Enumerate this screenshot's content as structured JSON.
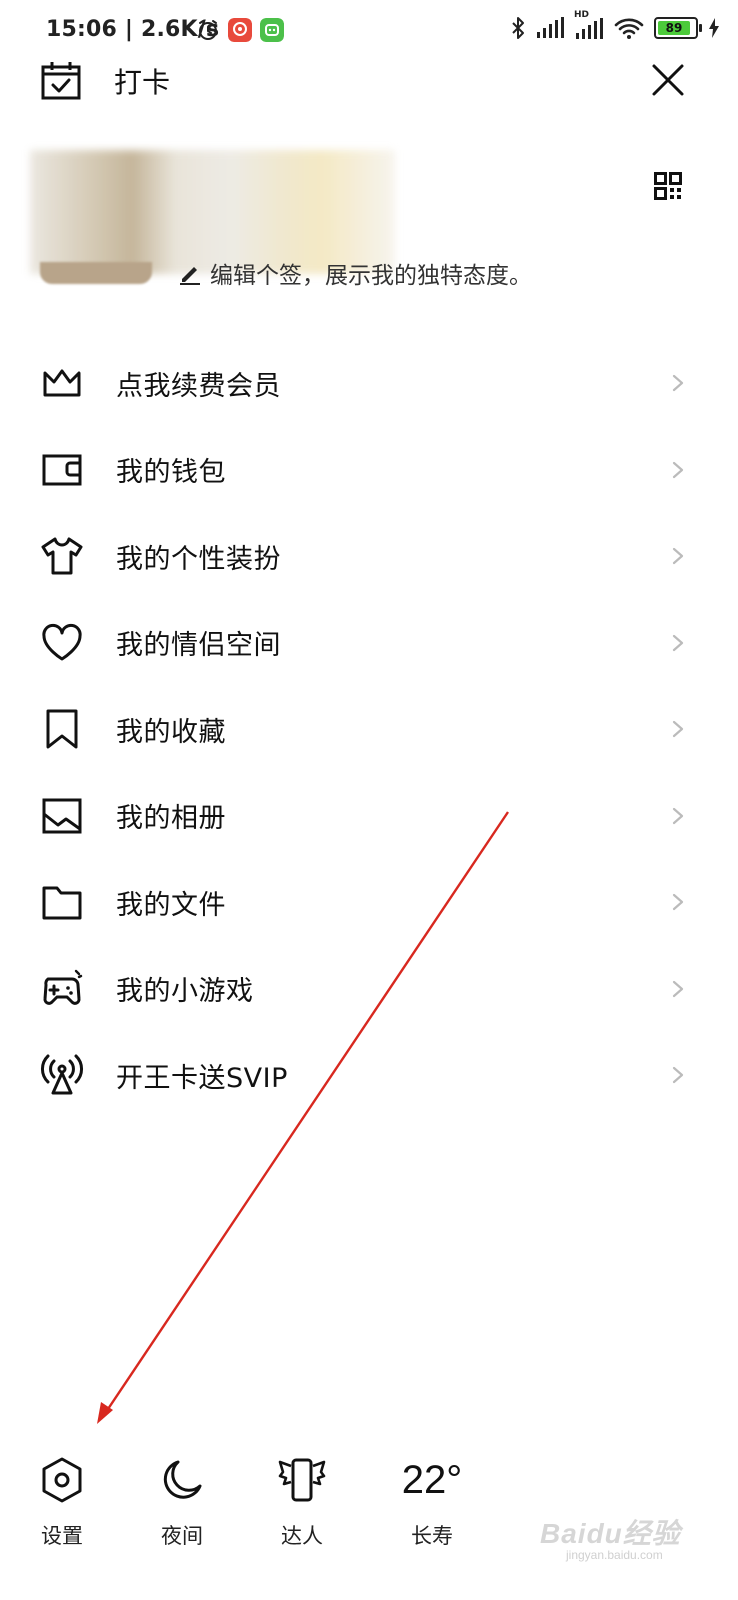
{
  "status_bar": {
    "time_speed": "15:06 | 2.6K/s",
    "battery": "89",
    "hd_label": "HD"
  },
  "header": {
    "checkin_label": "打卡"
  },
  "profile": {
    "signature": "编辑个签，展示我的独特态度。"
  },
  "menu": {
    "items": [
      {
        "label": "点我续费会员",
        "icon": "crown-icon"
      },
      {
        "label": "我的钱包",
        "icon": "wallet-icon"
      },
      {
        "label": "我的个性装扮",
        "icon": "tshirt-icon"
      },
      {
        "label": "我的情侣空间",
        "icon": "heart-icon"
      },
      {
        "label": "我的收藏",
        "icon": "bookmark-icon"
      },
      {
        "label": "我的相册",
        "icon": "photo-icon"
      },
      {
        "label": "我的文件",
        "icon": "folder-icon"
      },
      {
        "label": "我的小游戏",
        "icon": "gamepad-icon"
      },
      {
        "label": "开王卡送SVIP",
        "icon": "signal-tower-icon"
      }
    ]
  },
  "bottom_bar": {
    "settings": "设置",
    "night": "夜间",
    "expert": "达人",
    "temperature": "22°",
    "longevity": "长寿"
  },
  "watermark": {
    "brand": "Baidu经验",
    "url": "jingyan.baidu.com"
  },
  "colors": {
    "annotation_arrow": "#d8281f",
    "battery_fill": "#4ccb3a"
  }
}
